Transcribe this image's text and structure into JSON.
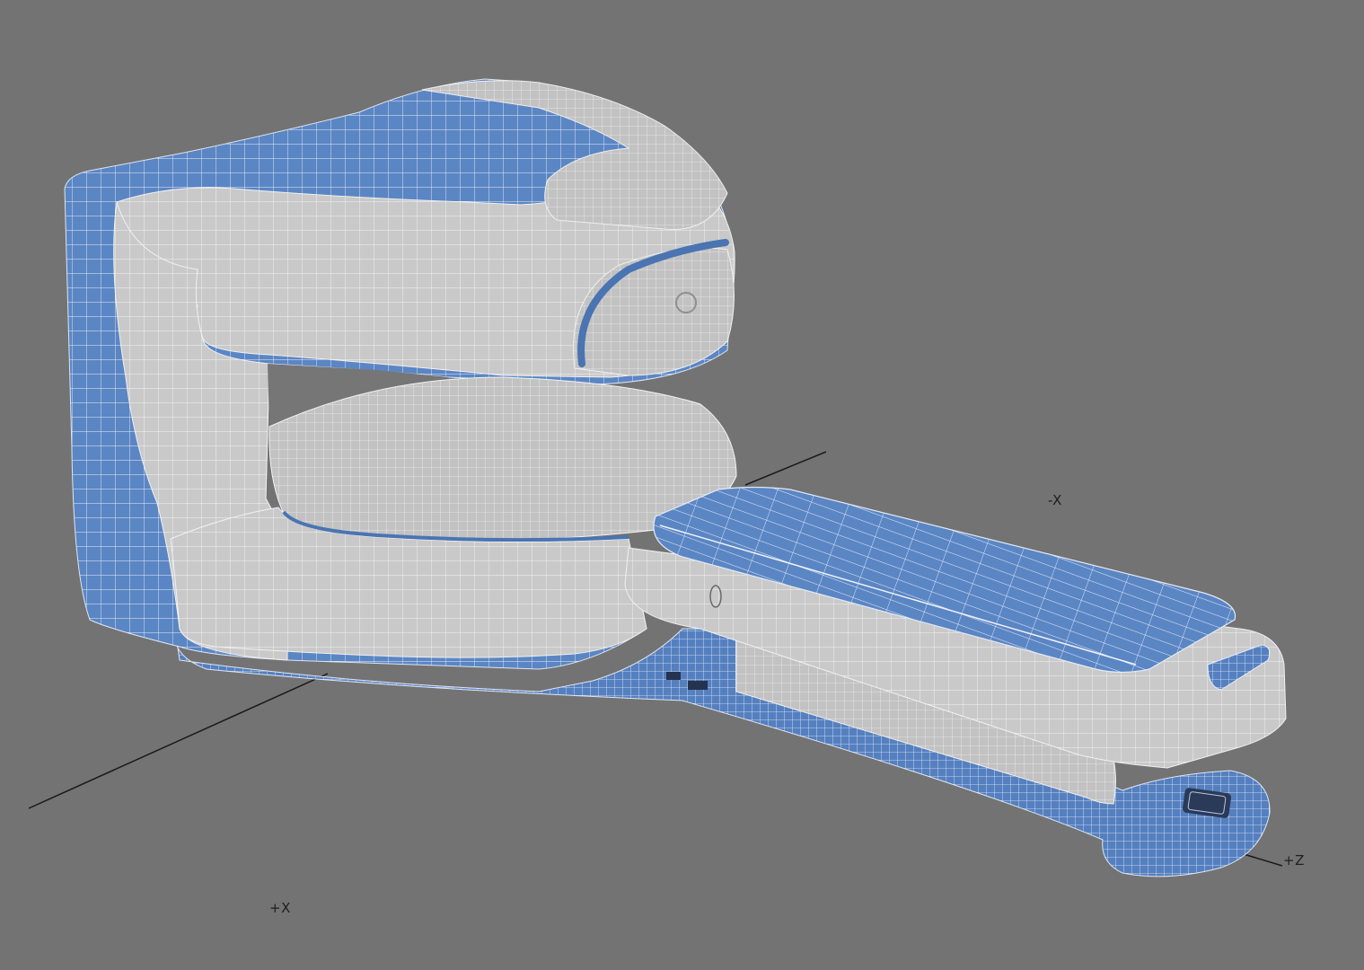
{
  "axes": {
    "neg_x_label": "-X",
    "pos_x_label": "+X",
    "pos_z_label": "+Z"
  },
  "colors": {
    "background": "#737373",
    "surface_gray": "#c8c8c8",
    "surface_blue": "#5c86c4",
    "wire": "#f2f2f2",
    "axis_line": "#1a1a1a"
  },
  "model": {
    "type": "mri-scanner-wireframe"
  }
}
